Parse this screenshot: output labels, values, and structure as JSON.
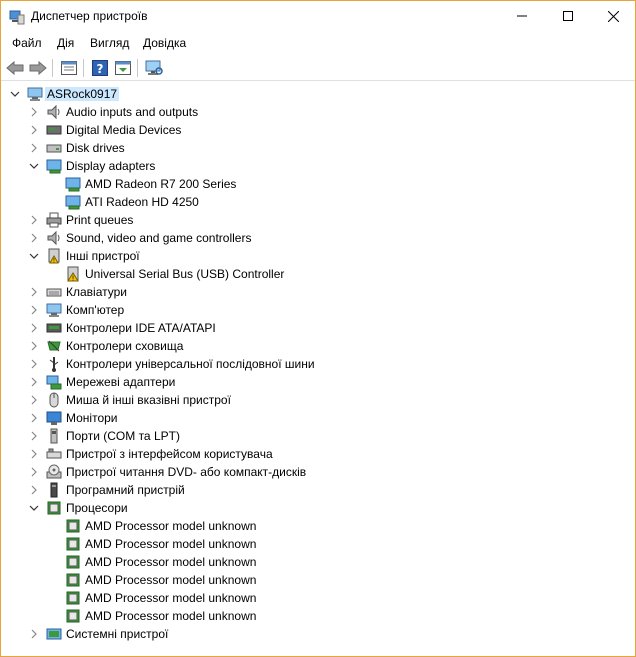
{
  "window": {
    "title": "Диспетчер пристроїв"
  },
  "menu": [
    "Файл",
    "Дія",
    "Вигляд",
    "Довідка"
  ],
  "tree": {
    "root": "ASRock0917",
    "items": [
      {
        "label": "Audio inputs and outputs",
        "icon": "speaker-icon",
        "expanded": false
      },
      {
        "label": "Digital Media Devices",
        "icon": "media-device-icon",
        "expanded": false
      },
      {
        "label": "Disk drives",
        "icon": "disk-drive-icon",
        "expanded": false
      },
      {
        "label": "Display adapters",
        "icon": "display-adapter-icon",
        "expanded": true,
        "children": [
          "AMD Radeon R7 200 Series",
          "ATI Radeon HD 4250"
        ]
      },
      {
        "label": "Print queues",
        "icon": "printer-icon",
        "expanded": false
      },
      {
        "label": "Sound, video and game controllers",
        "icon": "speaker-icon",
        "expanded": false
      },
      {
        "label": "Інші пристрої",
        "icon": "unknown-device-icon",
        "expanded": true,
        "children": [
          "Universal Serial Bus (USB) Controller"
        ]
      },
      {
        "label": "Клавіатури",
        "icon": "keyboard-icon",
        "expanded": false
      },
      {
        "label": "Комп'ютер",
        "icon": "computer-icon",
        "expanded": false
      },
      {
        "label": "Контролери IDE ATA/ATAPI",
        "icon": "ide-controller-icon",
        "expanded": false
      },
      {
        "label": "Контролери сховища",
        "icon": "storage-controller-icon",
        "expanded": false
      },
      {
        "label": "Контролери універсальної послідовної шини",
        "icon": "usb-icon",
        "expanded": false
      },
      {
        "label": "Мережеві адаптери",
        "icon": "network-adapter-icon",
        "expanded": false
      },
      {
        "label": "Миша й інші вказівні пристрої",
        "icon": "mouse-icon",
        "expanded": false
      },
      {
        "label": "Монітори",
        "icon": "monitor-icon",
        "expanded": false
      },
      {
        "label": "Порти (COM та LPT)",
        "icon": "port-icon",
        "expanded": false
      },
      {
        "label": "Пристрої з інтерфейсом користувача",
        "icon": "hid-icon",
        "expanded": false
      },
      {
        "label": "Пристрої читання DVD- або компакт-дисків",
        "icon": "dvd-drive-icon",
        "expanded": false
      },
      {
        "label": "Програмний пристрій",
        "icon": "software-device-icon",
        "expanded": false
      },
      {
        "label": "Процесори",
        "icon": "processor-icon",
        "expanded": true,
        "children": [
          "AMD Processor model unknown",
          "AMD Processor model unknown",
          "AMD Processor model unknown",
          "AMD Processor model unknown",
          "AMD Processor model unknown",
          "AMD Processor model unknown"
        ]
      },
      {
        "label": "Системні пристрої",
        "icon": "system-device-icon",
        "expanded": false
      }
    ]
  },
  "colors": {
    "accent_border": "#e8a33b",
    "selection": "#cce8ff"
  }
}
